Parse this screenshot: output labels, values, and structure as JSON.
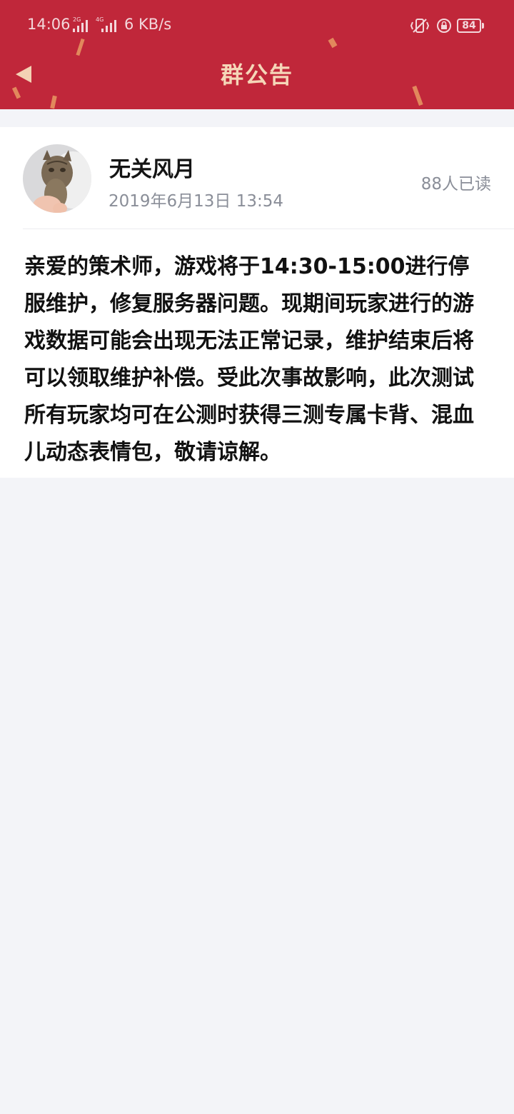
{
  "status_bar": {
    "time": "14:06",
    "network_1": "2G",
    "network_2": "4G",
    "net_speed": "6 KB/s",
    "battery": "84",
    "icons": [
      "vibrate-mute-icon",
      "rotation-lock-icon",
      "battery-icon"
    ]
  },
  "header": {
    "title": "群公告",
    "back_icon": "back-arrow-icon"
  },
  "notice": {
    "author": "无关风月",
    "time": "2019年6月13日 13:54",
    "read_count": "88人已读",
    "content": "亲爱的策术师，游戏将于14:30-15:00进行停服维护，修复服务器问题。现期间玩家进行的游戏数据可能会出现无法正常记录，维护结束后将可以领取维护补偿。受此次事故影响，此次测试所有玩家均可在公测时获得三测专属卡背、混血儿动态表情包，敬请谅解。"
  },
  "colors": {
    "header_bg": "#c0273a",
    "title_text": "#f5d6b8",
    "page_bg": "#f3f4f8",
    "card_bg": "#ffffff",
    "meta_text": "#8a8e98"
  }
}
